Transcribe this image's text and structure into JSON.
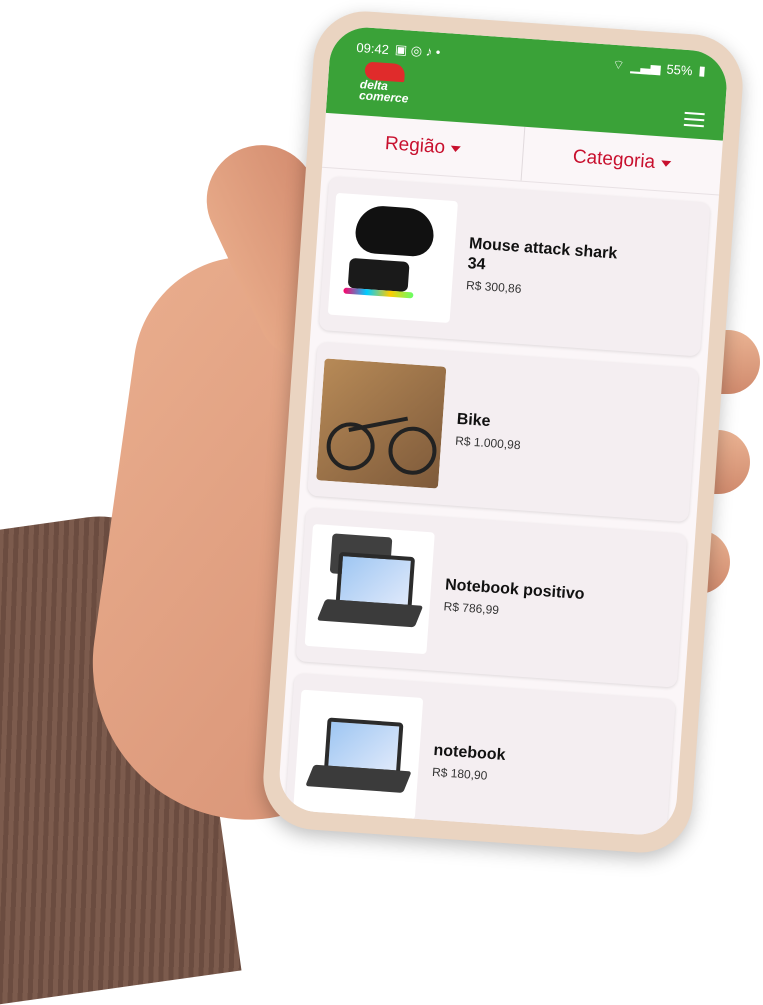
{
  "status": {
    "time": "09:42",
    "battery": "55%"
  },
  "brand": {
    "name_line1": "delta",
    "name_line2": "comerce"
  },
  "filters": {
    "region": "Região",
    "category": "Categoria"
  },
  "products": [
    {
      "name": "Mouse attack shark 34",
      "price": "R$ 300,86"
    },
    {
      "name": "Bike",
      "price": "R$ 1.000,98"
    },
    {
      "name": "Notebook positivo",
      "price": "R$ 786,99"
    },
    {
      "name": "notebook",
      "price": "R$ 180,90"
    }
  ],
  "colors": {
    "appbar": "#3aa238",
    "accent": "#c8102e"
  },
  "icons": [
    "menu-icon",
    "caret-down-icon",
    "wifi-icon",
    "signal-icon",
    "battery-icon"
  ]
}
